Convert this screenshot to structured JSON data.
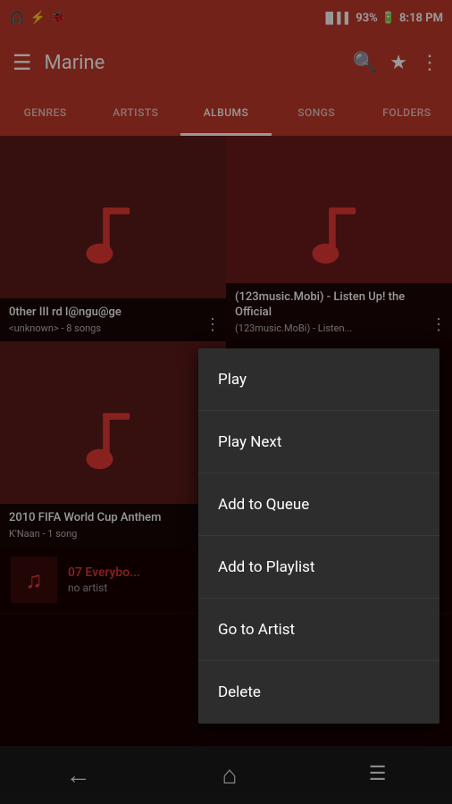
{
  "statusBar": {
    "battery": "93%",
    "time": "8:18 PM"
  },
  "toolbar": {
    "title": "Marine",
    "menuIcon": "≡",
    "searchIcon": "🔍",
    "favoriteIcon": "★",
    "moreIcon": "⋮"
  },
  "tabs": [
    {
      "id": "genres",
      "label": "GENRES",
      "active": false
    },
    {
      "id": "artists",
      "label": "ARTISTS",
      "active": false
    },
    {
      "id": "albums",
      "label": "ALBUMS",
      "active": true
    },
    {
      "id": "songs",
      "label": "SONGS",
      "active": false
    },
    {
      "id": "folders",
      "label": "FOLDERS",
      "active": false
    }
  ],
  "albums": [
    {
      "id": "album-1",
      "title": "0ther III rd l@ngu@ge",
      "sub": "<unknown> - 8 songs",
      "bgClass": "album-bg-1"
    },
    {
      "id": "album-2",
      "title": "(123music.Mobi) - Listen Up! the Official",
      "sub": "(123music.MoBi) - Listen...",
      "bgClass": "album-bg-2"
    },
    {
      "id": "album-3",
      "title": "2010 FIFA World Cup Anthem",
      "sub": "K'Naan - 1 song",
      "bgClass": "album-bg-1"
    }
  ],
  "songRow": {
    "title": "07 Everybo...",
    "artist": "no artist"
  },
  "contextMenu": {
    "items": [
      {
        "id": "play",
        "label": "Play"
      },
      {
        "id": "play-next",
        "label": "Play Next"
      },
      {
        "id": "add-to-queue",
        "label": "Add to Queue"
      },
      {
        "id": "add-to-playlist",
        "label": "Add to Playlist"
      },
      {
        "id": "go-to-artist",
        "label": "Go to Artist"
      },
      {
        "id": "delete",
        "label": "Delete"
      }
    ]
  },
  "bottomNav": {
    "backIcon": "←",
    "homeIcon": "⌂",
    "menuIcon": "≡"
  }
}
